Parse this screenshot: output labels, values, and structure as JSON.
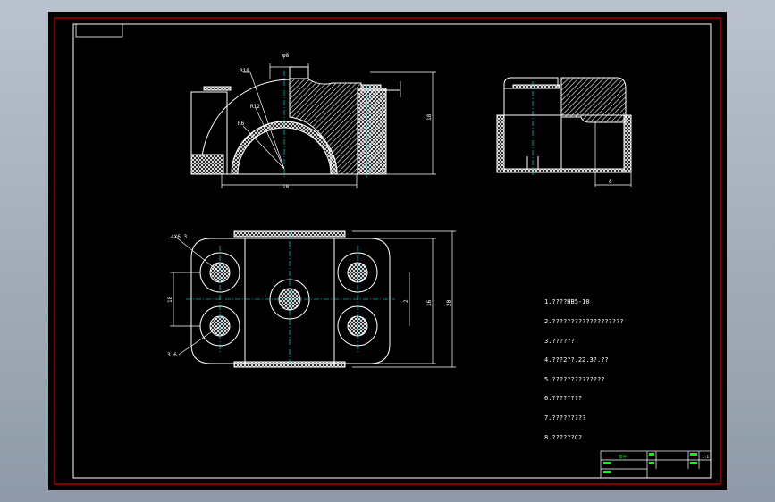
{
  "drawing": {
    "border_color": "#ff0000",
    "line_color": "#ffffff",
    "centerline_color": "#00ffff",
    "hatch_color": "#ffffff",
    "accent_color": "#00ff00"
  },
  "dimensions": {
    "top_width": "φ8",
    "radius_outer": "R18",
    "radius_mid": "R12",
    "radius_inner": "R6",
    "base_width": "18",
    "height_total": "18",
    "right_tab": "8",
    "plan_hole_large": "4X6.3",
    "plan_hole_small": "3.6",
    "plan_span_left": "18",
    "plan_span_right_a": "2",
    "plan_span_right_b": "16",
    "plan_span_right_c": "20"
  },
  "notes": [
    "1.????HB5-10",
    "2.???????????????????",
    "3.??????",
    "4.???2??.22.3?.??",
    "5.??????????????",
    "6.????????",
    "7.?????????",
    "8.??????C?"
  ],
  "title_block": {
    "name_cell": "零件",
    "cells": [
      "1:1",
      "",
      "",
      ""
    ]
  }
}
